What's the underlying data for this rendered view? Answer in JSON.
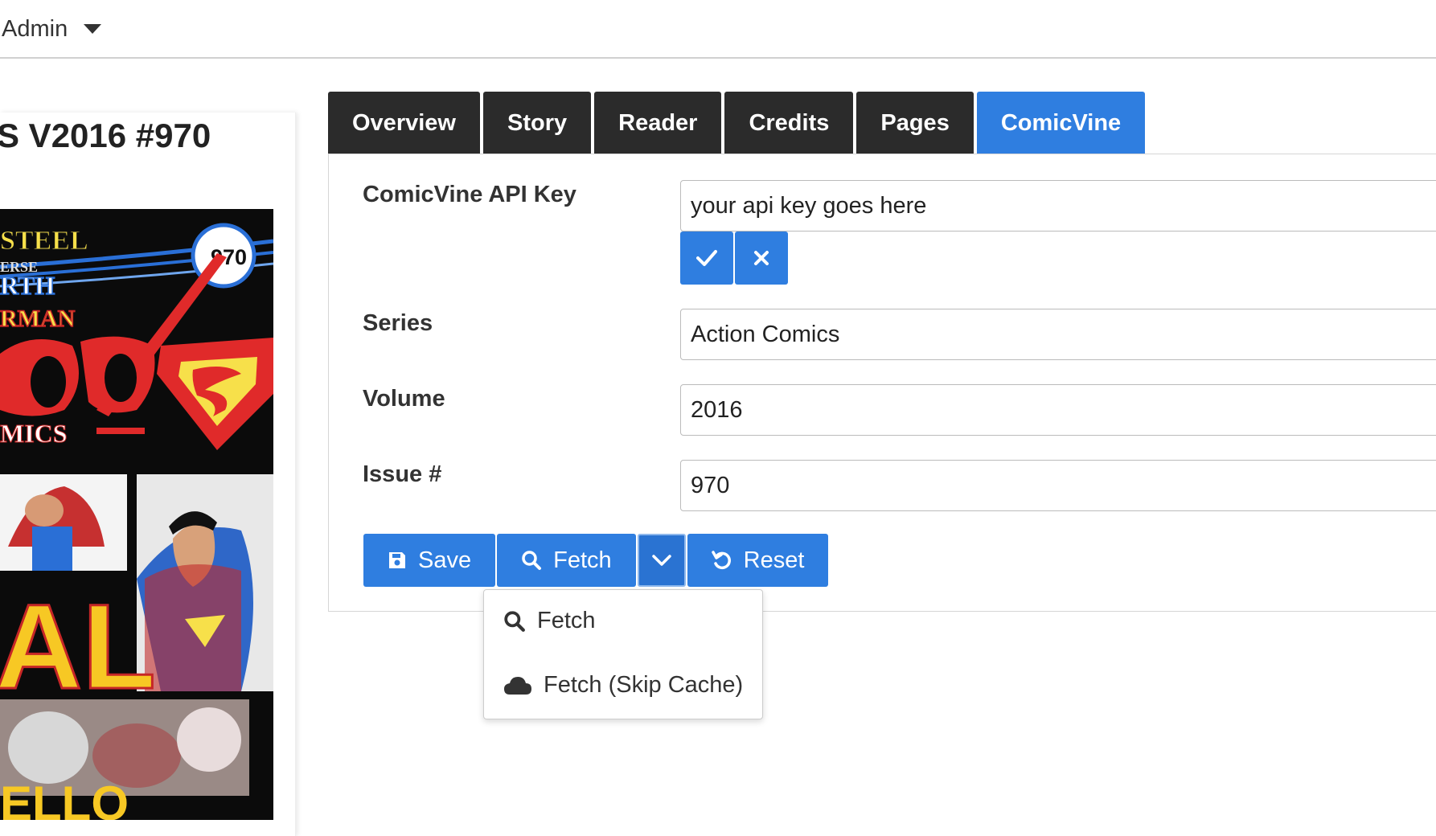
{
  "topbar": {
    "user_menu_label": "Admin"
  },
  "issue": {
    "title": "S V2016 #970",
    "cover_number": "970"
  },
  "tabs": [
    {
      "label": "Overview",
      "active": false
    },
    {
      "label": "Story",
      "active": false
    },
    {
      "label": "Reader",
      "active": false
    },
    {
      "label": "Credits",
      "active": false
    },
    {
      "label": "Pages",
      "active": false
    },
    {
      "label": "ComicVine",
      "active": true
    }
  ],
  "form": {
    "api_key": {
      "label": "ComicVine API Key",
      "value": "your api key goes here"
    },
    "series": {
      "label": "Series",
      "value": "Action Comics"
    },
    "volume": {
      "label": "Volume",
      "value": "2016"
    },
    "issue": {
      "label": "Issue #",
      "value": "970"
    }
  },
  "actions": {
    "save_label": "Save",
    "fetch_label": "Fetch",
    "reset_label": "Reset"
  },
  "dropdown": {
    "items": [
      {
        "label": "Fetch",
        "icon": "search-icon"
      },
      {
        "label": "Fetch (Skip Cache)",
        "icon": "cloud-icon"
      }
    ]
  },
  "colors": {
    "accent": "#2f7ee0",
    "tab_dark": "#2b2b2b"
  }
}
